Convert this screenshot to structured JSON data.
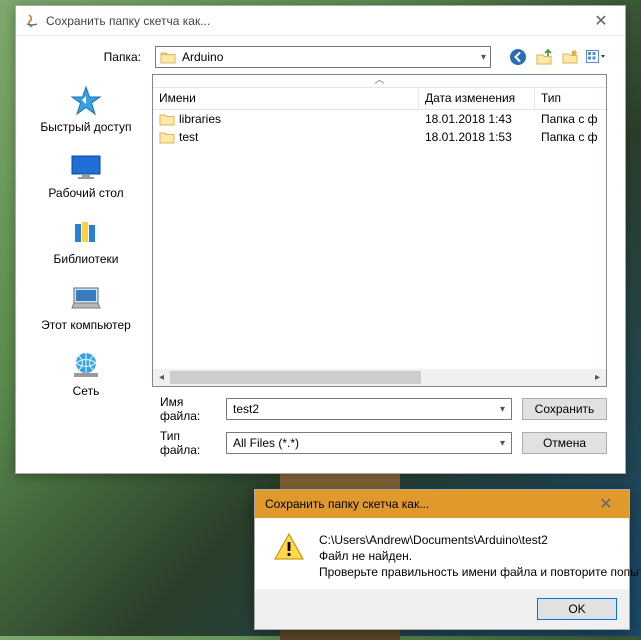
{
  "dialog": {
    "title": "Сохранить папку скетча как...",
    "folder_label": "Папка:",
    "folder_value": "Arduino",
    "places": {
      "quick": "Быстрый доступ",
      "desktop": "Рабочий стол",
      "libraries": "Библиотеки",
      "computer": "Этот компьютер",
      "network": "Сеть"
    },
    "columns": {
      "name": "Имени",
      "date": "Дата изменения",
      "type": "Тип"
    },
    "rows": [
      {
        "name": "libraries",
        "date": "18.01.2018 1:43",
        "type": "Папка с ф"
      },
      {
        "name": "test",
        "date": "18.01.2018 1:53",
        "type": "Папка с ф"
      }
    ],
    "filename_label": "Имя файла:",
    "filename_value": "test2",
    "filetype_label": "Тип файла:",
    "filetype_value": "All Files (*.*)",
    "save_label": "Сохранить",
    "cancel_label": "Отмена"
  },
  "error": {
    "title": "Сохранить папку скетча как...",
    "line1": "C:\\Users\\Andrew\\Documents\\Arduino\\test2",
    "line2": "Файл не найден.",
    "line3": "Проверьте правильность имени файла и повторите попытку.",
    "ok": "OK"
  }
}
